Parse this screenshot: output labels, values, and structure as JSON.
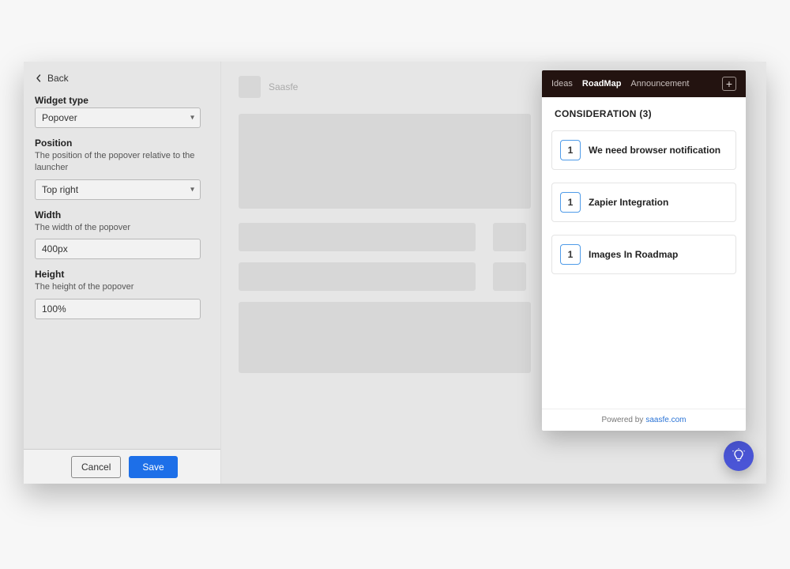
{
  "sidebar": {
    "back_label": "Back",
    "widget_type_label": "Widget type",
    "widget_type_value": "Popover",
    "position_label": "Position",
    "position_help": "The position of the popover relative to the launcher",
    "position_value": "Top right",
    "width_label": "Width",
    "width_help": "The width of the popover",
    "width_value": "400px",
    "height_label": "Height",
    "height_help": "The height of the popover",
    "height_value": "100%",
    "cancel_label": "Cancel",
    "save_label": "Save"
  },
  "preview": {
    "brand": "Saasfe"
  },
  "popover": {
    "tabs": {
      "ideas": "Ideas",
      "roadmap": "RoadMap",
      "announcement": "Announcement"
    },
    "section_title": "CONSIDERATION (3)",
    "items": [
      {
        "votes": "1",
        "title": "We need browser notification"
      },
      {
        "votes": "1",
        "title": "Zapier Integration"
      },
      {
        "votes": "1",
        "title": "Images In Roadmap"
      }
    ],
    "footer_prefix": "Powered by",
    "footer_link": "saasfe.com"
  }
}
